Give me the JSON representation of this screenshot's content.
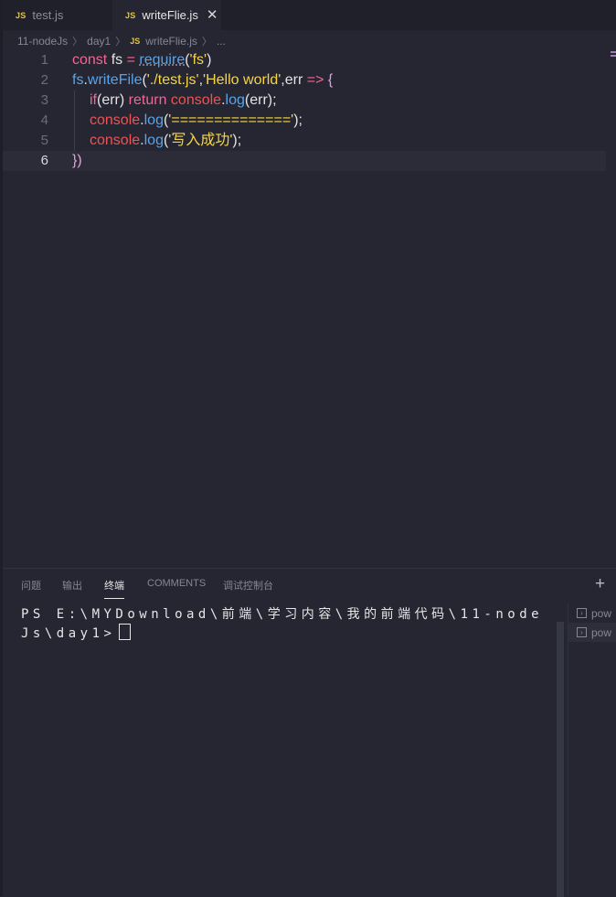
{
  "tabs": [
    {
      "icon": "JS",
      "label": "test.js",
      "active": false
    },
    {
      "icon": "JS",
      "label": "writeFlie.js",
      "active": true,
      "close": "✕"
    }
  ],
  "breadcrumb": {
    "folder1": "11-nodeJs",
    "folder2": "day1",
    "icon": "JS",
    "file": "writeFlie.js",
    "more": "..."
  },
  "editor": {
    "lines": [
      "1",
      "2",
      "3",
      "4",
      "5",
      "6"
    ],
    "code": {
      "l1": {
        "const": "const",
        "fs": "fs",
        "eq": "=",
        "require": "require",
        "p1": "(",
        "str": "'fs'",
        "p2": ")"
      },
      "l2": {
        "fs": "fs",
        "dot": ".",
        "fn": "writeFile",
        "p1": "(",
        "s1": "'./test.js'",
        "c1": ",",
        "s2": "'Hello world'",
        "c2": ",err",
        "arrow": "=>",
        "brace": "{"
      },
      "l3": {
        "if": "if",
        "p1": "(",
        "err": "err",
        "p2": ")",
        "ret": "return",
        "console": "console",
        "dot": ".",
        "log": "log",
        "p3": "(",
        "err2": "err",
        "p4": ");"
      },
      "l4": {
        "console": "console",
        "dot": ".",
        "log": "log",
        "p1": "(",
        "str": "'=============='",
        "p2": ");"
      },
      "l5": {
        "console": "console",
        "dot": ".",
        "log": "log",
        "p1": "(",
        "str": "'写入成功'",
        "p2": ");"
      },
      "l6": {
        "brace": "}",
        "paren": ")"
      }
    }
  },
  "panel": {
    "tabs": [
      "问题",
      "输出",
      "终端",
      "COMMENTS",
      "调试控制台"
    ],
    "active_tab": "终端",
    "add": "+",
    "terminal": {
      "prompt": "PS E:\\MYDownload\\前端\\学习内容\\我的前端代码\\11-nodeJs\\day1>"
    },
    "terminals": [
      "pow",
      "pow"
    ]
  },
  "colors": {
    "background": "#252632",
    "tabbar": "#1f2029",
    "keyword": "#f36595",
    "function": "#59a4e8",
    "string": "#f6d547",
    "object": "#f05252"
  }
}
